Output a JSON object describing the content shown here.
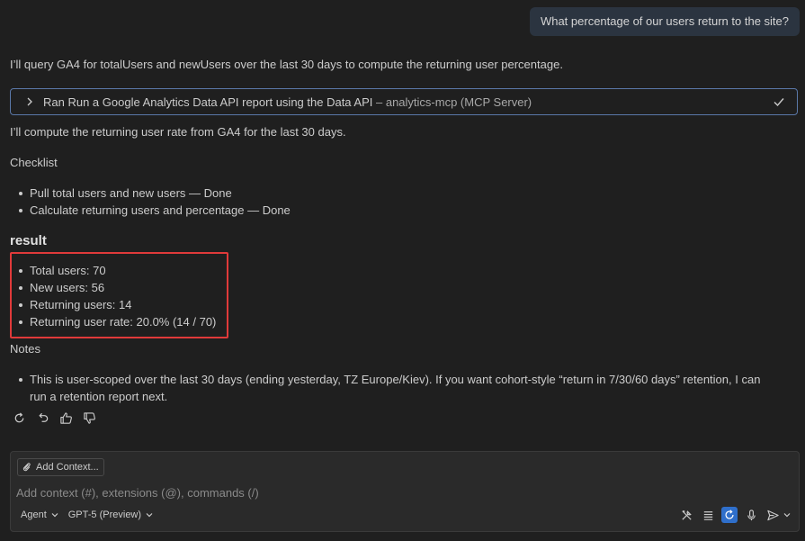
{
  "user_message": "What percentage of our users return to the site?",
  "assistant": {
    "intro": "I’ll query GA4 for totalUsers and newUsers over the last 30 days to compute the returning user percentage.",
    "tool_call": {
      "label_main": "Ran Run a Google Analytics Data API report using the Data API",
      "label_server": " – analytics-mcp (MCP Server)"
    },
    "compute_line": "I’ll compute the returning user rate from GA4 for the last 30 days.",
    "checklist_title": "Checklist",
    "checklist": [
      "Pull total users and new users — Done",
      "Calculate returning users and percentage — Done"
    ],
    "result_heading": "result",
    "results": [
      "Total users: 70",
      "New users: 56",
      "Returning users: 14",
      "Returning user rate: 20.0% (14 / 70)"
    ],
    "notes_title": "Notes",
    "notes": [
      "This is user-scoped over the last 30 days (ending yesterday, TZ Europe/Kiev). If you want cohort-style “return in 7/30/60 days” retention, I can run a retention report next."
    ],
    "actions": [
      "retry-icon",
      "undo-icon",
      "thumbs-up-icon",
      "thumbs-down-icon"
    ]
  },
  "composer": {
    "add_context_label": "Add Context...",
    "placeholder": "Add context (#), extensions (@), commands (/)",
    "mode": "Agent",
    "model": "GPT-5 (Preview)",
    "tools": [
      "tools-icon",
      "list-icon",
      "auto-approve-icon",
      "microphone-icon"
    ],
    "send": "send-icon"
  },
  "colors": {
    "background": "#1f1f1f",
    "user_bubble": "#2b3440",
    "tool_border": "#5a78a8",
    "highlight": "#e03a3a",
    "accent": "#2f6fcb"
  }
}
